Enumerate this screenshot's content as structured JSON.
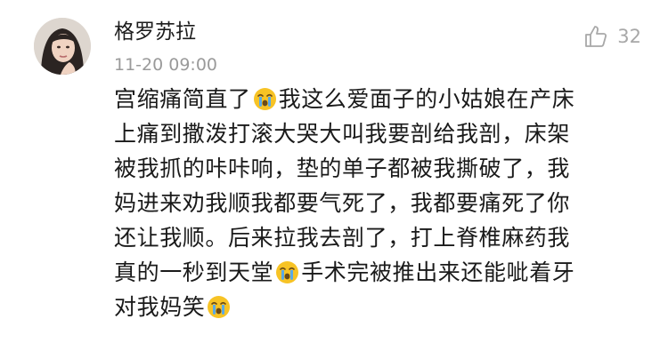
{
  "comment": {
    "username": "格罗苏拉",
    "timestamp": "11-20 09:00",
    "like_count": "32",
    "avatar_icon": "user-avatar",
    "like_icon": "thumbs-up-icon",
    "emoji_icon": "crying-face-emoji",
    "body_lines": [
      {
        "before": "宫缩痛简直了",
        "emoji": true,
        "after": "我这么爱面子的小姑娘在产床"
      },
      {
        "before": "上痛到撒泼打滚大哭大叫我要剖给我剖，床架"
      },
      {
        "before": "被我抓的咔咔响，垫的单子都被我撕破了，我"
      },
      {
        "before": "妈进来劝我顺我都要气死了，我都要痛死了你"
      },
      {
        "before": "还让我顺。后来拉我去剖了，打上脊椎麻药我"
      },
      {
        "before": "真的一秒到天堂",
        "emoji": true,
        "after": "手术完被推出来还能呲着牙"
      },
      {
        "before": "对我妈笑",
        "emoji": true
      }
    ]
  },
  "colors": {
    "username": "#1c1c1c",
    "timestamp": "#9a9a9a",
    "like": "#a8a8a8",
    "body_text": "#1a1a1a",
    "emoji_face": "#f7c325",
    "emoji_tear": "#5aa9e6"
  }
}
